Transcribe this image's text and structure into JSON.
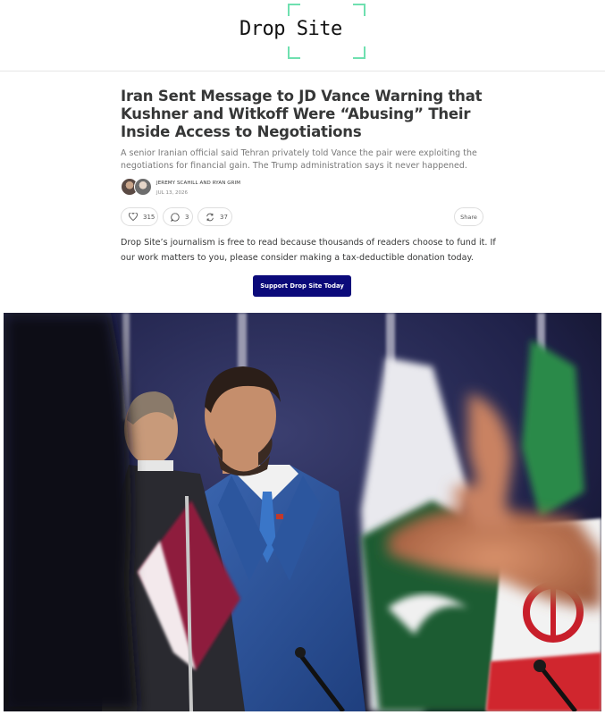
{
  "header": {
    "logo_text": "Drop Site",
    "accent_color": "#6fe0b0"
  },
  "article": {
    "title": "Iran Sent Message to JD Vance Warning that Kushner and Witkoff Were “Abusing” Their Inside Access to Negotiations",
    "subtitle": "A senior Iranian official said Tehran privately told Vance the pair were exploiting the negotiations for financial gain. The Trump administration says it never happened.",
    "authors": "JEREMY SCAHILL AND RYAN GRIM",
    "date": "JUL 13, 2026"
  },
  "actions": {
    "likes": "315",
    "comments": "3",
    "restacks": "37",
    "share_label": "Share"
  },
  "cta": {
    "text": "Drop Site’s journalism is free to read because thousands of readers choose to fund it. If our work matters to you, please consider making a tax-deductible donation today.",
    "button_label": "Support Drop Site Today",
    "button_color": "#0b0a7a"
  },
  "photo": {
    "subject": "man in blue suit among flags"
  }
}
